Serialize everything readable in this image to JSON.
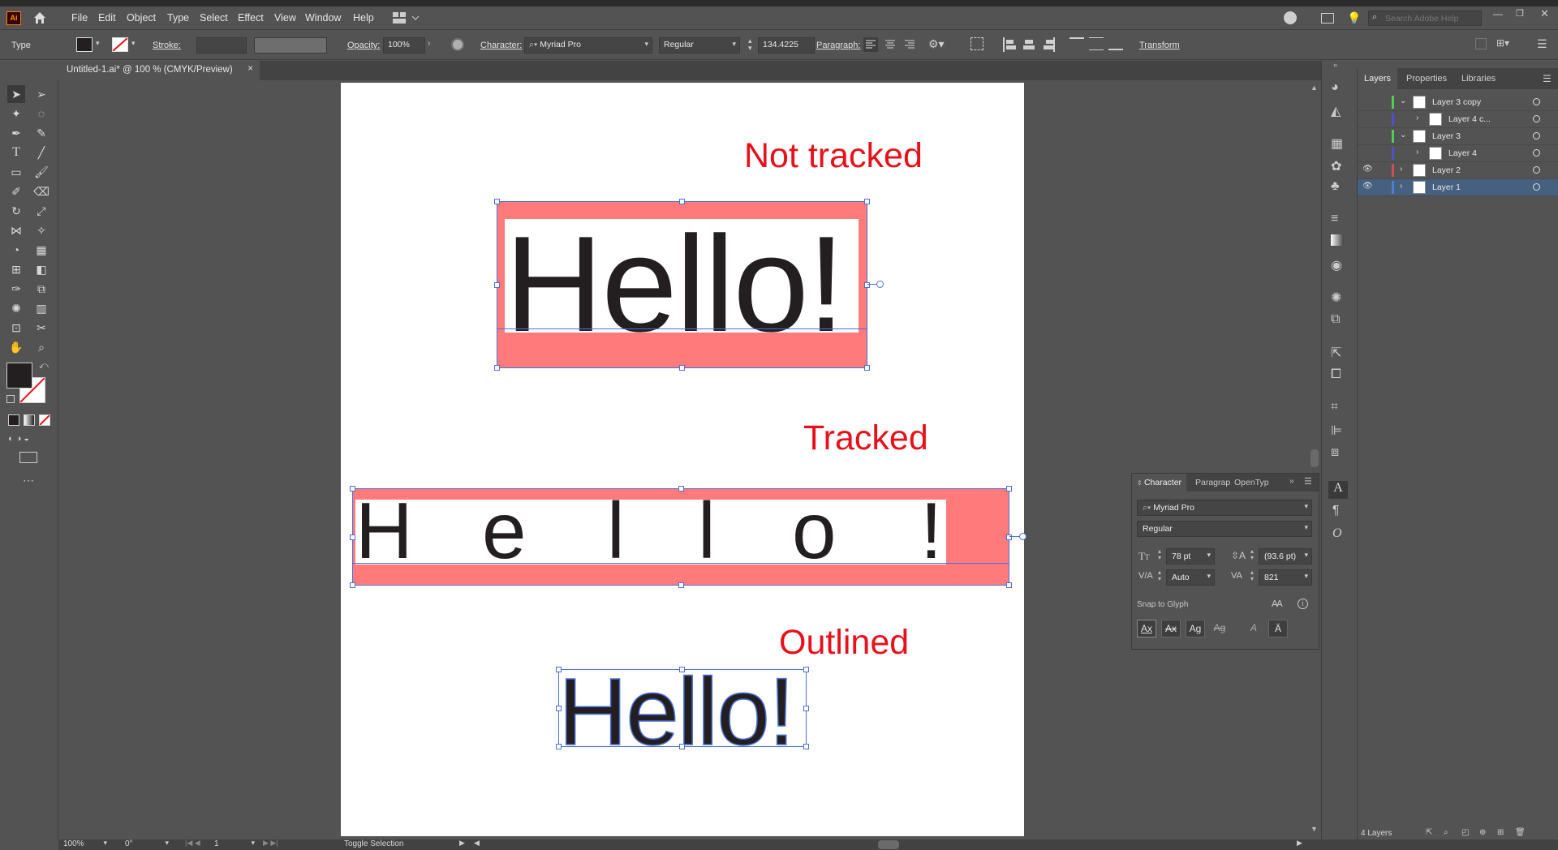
{
  "app": {
    "logo": "Ai",
    "home_icon": "home-icon"
  },
  "menu": [
    "File",
    "Edit",
    "Object",
    "Type",
    "Select",
    "Effect",
    "View",
    "Window",
    "Help"
  ],
  "search": {
    "placeholder": "Search Adobe Help"
  },
  "control_bar": {
    "selection_type": "Type",
    "stroke_label": "Stroke:",
    "opacity_label": "Opacity:",
    "opacity_value": "100%",
    "character_label": "Character:",
    "font_family": "Myriad Pro",
    "font_style": "Regular",
    "font_size": "134.4225",
    "paragraph_label": "Paragraph:",
    "transform_label": "Transform"
  },
  "document": {
    "tab_title": "Untitled-1.ai* @ 100 % (CMYK/Preview)",
    "close": "×"
  },
  "artboard": {
    "label_not_tracked": "Not tracked",
    "label_tracked": "Tracked",
    "label_outlined": "Outlined",
    "hello_text": "Hello!",
    "tracked_letters": [
      "H",
      "e",
      "l",
      "l",
      "o",
      "!"
    ]
  },
  "layers_panel": {
    "tabs": [
      "Layers",
      "Properties",
      "Libraries"
    ],
    "rows": [
      {
        "name": "Layer 3 copy",
        "visible": false,
        "color": "#4fd14f",
        "expanded": true
      },
      {
        "name": "Layer 4 c...",
        "visible": false,
        "color": "#4f4fd1",
        "expanded": false
      },
      {
        "name": "Layer 3",
        "visible": false,
        "color": "#4fd14f",
        "expanded": true
      },
      {
        "name": "Layer 4",
        "visible": false,
        "color": "#4f4fd1",
        "expanded": false
      },
      {
        "name": "Layer 2",
        "visible": true,
        "color": "#d14f4f",
        "expanded": false
      },
      {
        "name": "Layer 1",
        "visible": true,
        "color": "#4f7fd1",
        "expanded": false
      }
    ],
    "footer_count": "4 Layers"
  },
  "character_panel": {
    "tabs": [
      "Character",
      "Paragrap",
      "OpenTyp"
    ],
    "font_family": "Myriad Pro",
    "font_style": "Regular",
    "font_size": "78 pt",
    "leading": "(93.6 pt)",
    "kerning": "Auto",
    "tracking": "821",
    "snap_label": "Snap to Glyph"
  },
  "status_bar": {
    "zoom": "100%",
    "rotation": "0°",
    "artboard_num": "1",
    "status_text": "Toggle Selection"
  },
  "colors": {
    "accent_red": "#e8101a",
    "highlight_pink": "#ff7b7b",
    "selection_blue": "#4a6fd8"
  }
}
